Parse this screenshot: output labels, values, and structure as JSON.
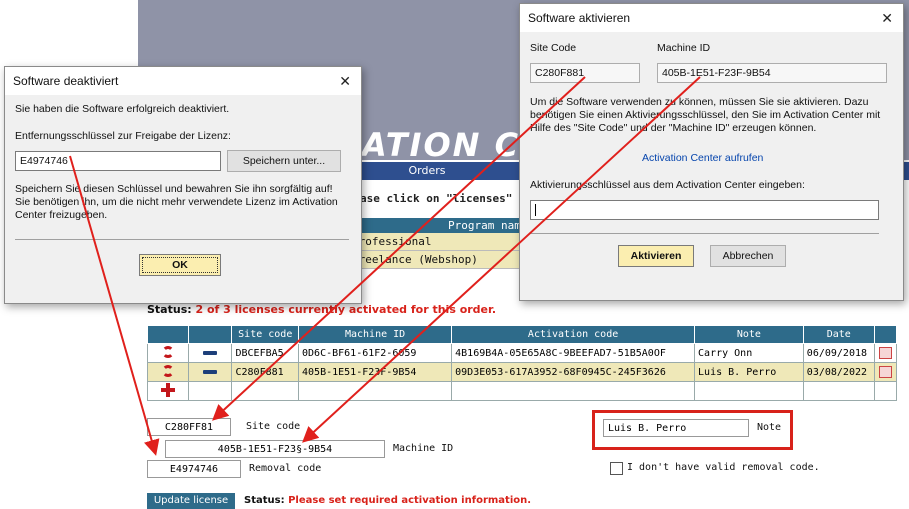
{
  "webpage": {
    "banner_title": "ATION CEN",
    "tab_orders": "Orders",
    "hint_text": "ase click on \"licenses\" button",
    "program_header": "Program nam",
    "programs": [
      "Professional",
      "Freelance (Webshop)"
    ],
    "status_top_label": "Status:",
    "status_top_text": "2 of 3 licenses currently activated for this order."
  },
  "license_table": {
    "headers": [
      "",
      "",
      "Site code",
      "Machine ID",
      "Activation code",
      "Note",
      "Date",
      ""
    ],
    "rows": [
      {
        "site_code": "DBCEFBA5",
        "machine_id": "0D6C-BF61-61F2-6059",
        "activation_code": "4B169B4A-05E65A8C-9BEEFAD7-51B5A0OF",
        "note": "Carry Onn",
        "date": "06/09/2018",
        "highlighted": false
      },
      {
        "site_code": "C280F881",
        "machine_id": "405B-1E51-F23F-9B54",
        "activation_code": "09D3E053-617A3952-68F0945C-245F3626",
        "note": "Luis B. Perro",
        "date": "03/08/2022",
        "highlighted": true
      }
    ]
  },
  "form": {
    "site_code_value": "C280FF81",
    "site_code_label": "Site code",
    "machine_id_value": "405B-1E51-F23§-9B54",
    "machine_id_label": "Machine ID",
    "removal_code_value": "E4974746",
    "removal_code_label": "Removal code",
    "note_value": "Luis B. Perro",
    "note_label": "Note",
    "no_removal_label": "I don't have valid removal code.",
    "update_button": "Update license",
    "status_label": "Status:",
    "status_text": "Please set required activation information."
  },
  "deactivate_dialog": {
    "title": "Software deaktiviert",
    "message": "Sie haben die Software erfolgreich deaktiviert.",
    "key_label": "Entfernungsschlüssel zur Freigabe der Lizenz:",
    "key_value": "E4974746",
    "save_button": "Speichern unter...",
    "info_line1": "Speichern Sie diesen Schlüssel und bewahren Sie ihn sorgfältig auf!",
    "info_line2": "Sie benötigen ihn, um die nicht mehr verwendete Lizenz im Activation",
    "info_line3": "Center freizugeben.",
    "ok_button": "OK"
  },
  "activate_dialog": {
    "title": "Software aktivieren",
    "site_code_label": "Site Code",
    "site_code_value": "C280F881",
    "machine_id_label": "Machine ID",
    "machine_id_value": "405B-1E51-F23F-9B54",
    "info_line1": "Um die Software verwenden zu können, müssen Sie sie aktivieren. Dazu",
    "info_line2": "benötigen Sie einen Aktivierungsschlüssel, den Sie im Activation Center mit",
    "info_line3": "Hilfe des \"Site Code\" und der \"Machine ID\" erzeugen können.",
    "link_text": "Activation Center aufrufen",
    "key_label": "Aktivierungsschlüssel aus dem Activation Center eingeben:",
    "activate_button": "Aktivieren",
    "cancel_button": "Abbrechen"
  },
  "colors": {
    "accent_red": "#d8221a",
    "header_blue": "#2e6b8a",
    "highlight_row": "#efe8b8"
  }
}
